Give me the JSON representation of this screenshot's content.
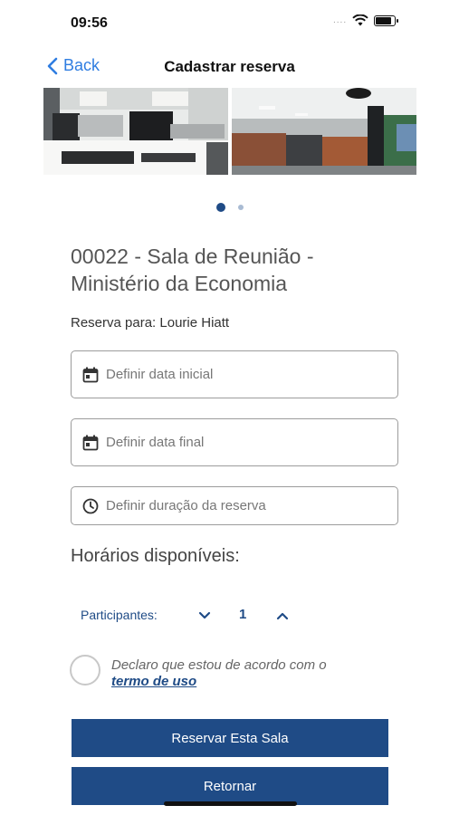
{
  "status_bar": {
    "time": "09:56",
    "signal": "....",
    "icons": [
      "wifi-icon",
      "battery-icon"
    ]
  },
  "nav": {
    "back_label": "Back",
    "title": "Cadastrar reserva"
  },
  "carousel": {
    "total": 2,
    "active": 1
  },
  "room": {
    "title": "00022 - Sala de Reunião - Ministério da Economia"
  },
  "reservation_for": "Reserva para: Lourie Hiatt",
  "fields": {
    "start_date_placeholder": "Definir data inicial",
    "end_date_placeholder": "Definir data final",
    "duration_placeholder": "Definir duração da reserva"
  },
  "available_times_heading": "Horários disponíveis:",
  "participants": {
    "label": "Participantes:",
    "value": "1"
  },
  "terms": {
    "text": "Declaro que estou de acordo com o",
    "link": "termo de uso"
  },
  "buttons": {
    "reserve": "Reservar Esta Sala",
    "back": "Retornar"
  },
  "colors": {
    "primary": "#1f4b86",
    "ios_blue": "#2f7de1",
    "border": "#9c9c9c"
  }
}
